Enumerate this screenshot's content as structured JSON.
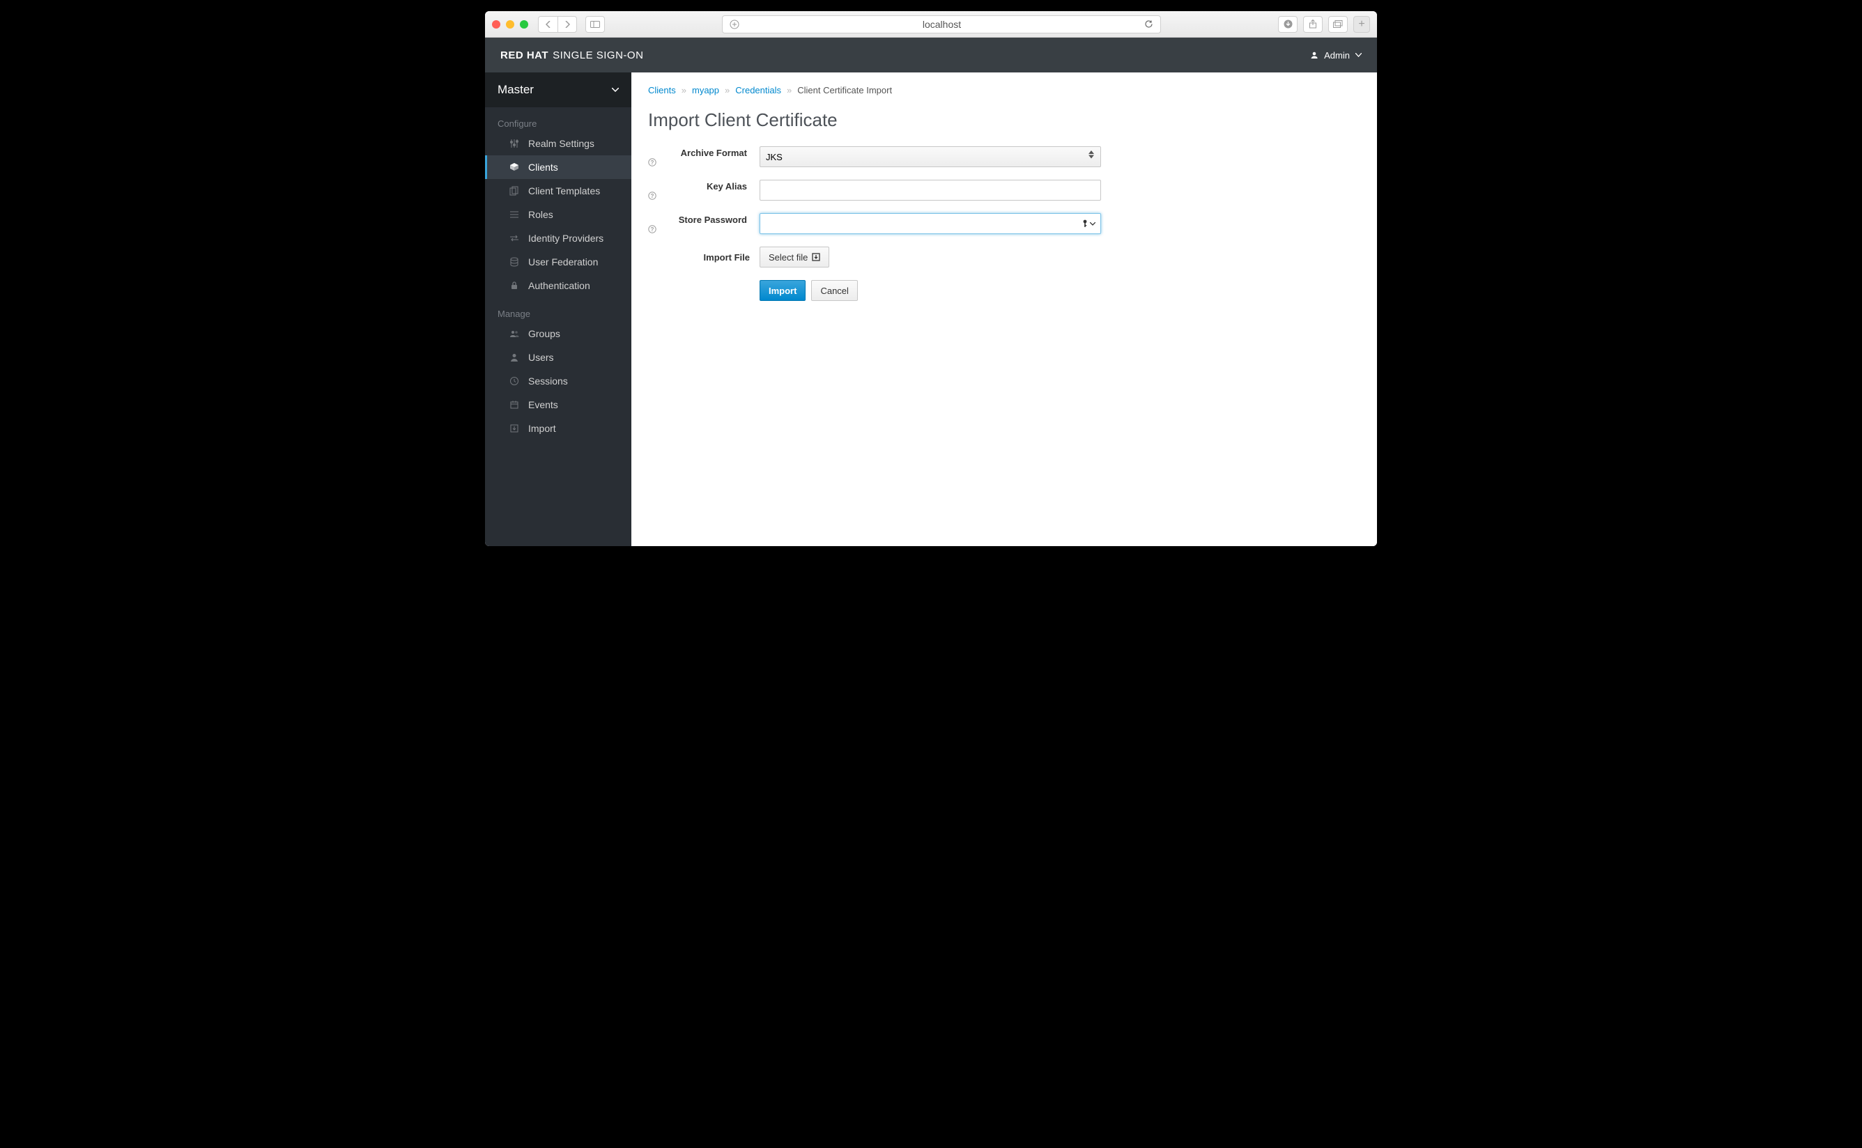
{
  "browser": {
    "host": "localhost"
  },
  "header": {
    "brand_bold": "RED HAT",
    "brand_light": "SINGLE SIGN-ON",
    "user": "Admin"
  },
  "sidebar": {
    "realm": "Master",
    "section_configure": "Configure",
    "section_manage": "Manage",
    "configure": [
      {
        "label": "Realm Settings"
      },
      {
        "label": "Clients"
      },
      {
        "label": "Client Templates"
      },
      {
        "label": "Roles"
      },
      {
        "label": "Identity Providers"
      },
      {
        "label": "User Federation"
      },
      {
        "label": "Authentication"
      }
    ],
    "manage": [
      {
        "label": "Groups"
      },
      {
        "label": "Users"
      },
      {
        "label": "Sessions"
      },
      {
        "label": "Events"
      },
      {
        "label": "Import"
      }
    ]
  },
  "breadcrumb": {
    "a": "Clients",
    "b": "myapp",
    "c": "Credentials",
    "d": "Client Certificate Import"
  },
  "page": {
    "title": "Import Client Certificate",
    "labels": {
      "archive": "Archive Format",
      "alias": "Key Alias",
      "storepwd": "Store Password",
      "importfile": "Import File"
    },
    "archive_value": "JKS",
    "select_file": "Select file",
    "import_btn": "Import",
    "cancel_btn": "Cancel"
  }
}
